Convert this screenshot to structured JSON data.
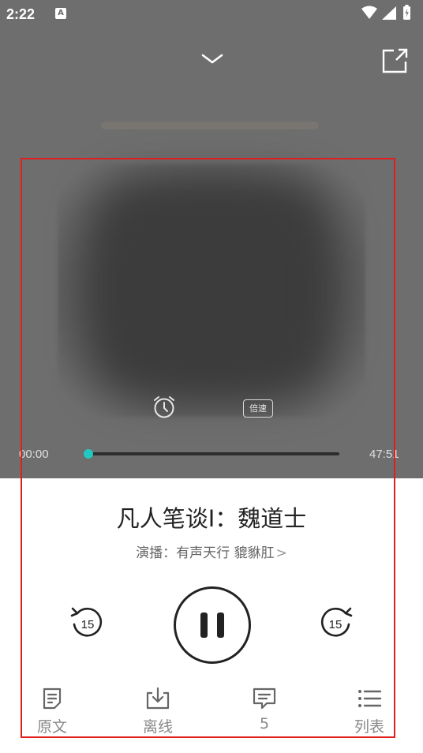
{
  "status_bar": {
    "time": "2:22",
    "notif_badge": "A"
  },
  "player": {
    "timer_icon": "alarm-clock-icon",
    "speed_label": "倍速",
    "current_time": "00:00",
    "total_time": "47:51",
    "progress_fraction": 0.0,
    "accent_color": "#21c9c0"
  },
  "track": {
    "title": "凡人笔谈I：魏道士",
    "narrator": "演播：有声天行 貔貅肛",
    "narrator_chevron": ">"
  },
  "controls": {
    "rewind_seconds": "15",
    "forward_seconds": "15"
  },
  "bottom_bar": {
    "items": [
      {
        "label": "原文",
        "icon": "document-icon"
      },
      {
        "label": "离线",
        "icon": "download-icon"
      },
      {
        "label": "5",
        "icon": "comment-icon"
      },
      {
        "label": "列表",
        "icon": "list-icon"
      }
    ]
  }
}
